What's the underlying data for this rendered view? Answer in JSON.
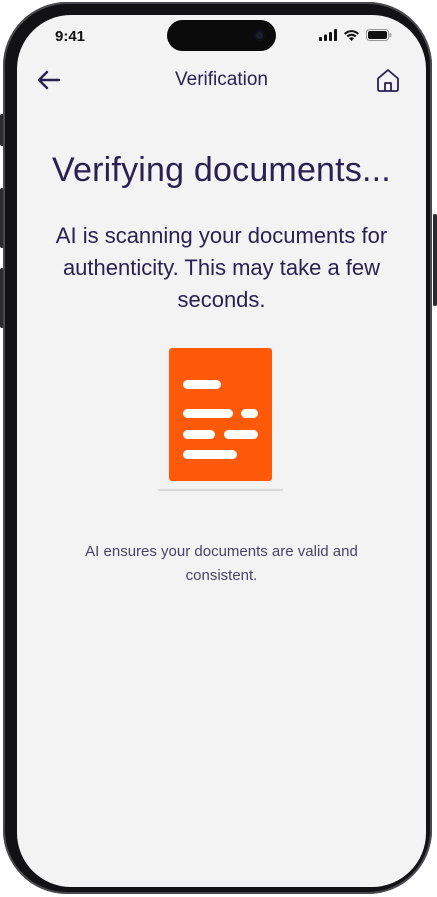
{
  "status_bar": {
    "time": "9:41",
    "icons": [
      "signal-icon",
      "wifi-icon",
      "battery-icon"
    ]
  },
  "nav": {
    "back_icon": "arrow-left-icon",
    "title": "Verification",
    "home_icon": "home-icon"
  },
  "main": {
    "heading": "Verifying documents...",
    "description": "AI is scanning your documents for authenticity. This may take a few seconds.",
    "illustration_icon": "document-icon",
    "note": "AI ensures your documents are valid and consistent."
  },
  "colors": {
    "accent": "#ff5a0a",
    "text": "#2a2150",
    "background": "#f3f3f4"
  }
}
